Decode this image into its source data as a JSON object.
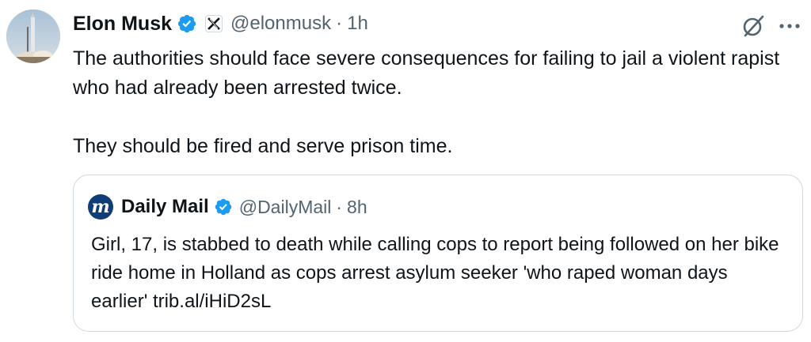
{
  "tweet": {
    "author": {
      "name": "Elon Musk",
      "handle": "@elonmusk",
      "avatar_icon": "rocket-launch-avatar",
      "verified_icon": "verified-badge-icon",
      "affiliation_icon": "x-logo-icon"
    },
    "separator": "·",
    "time": "1h",
    "paragraphs": [
      "The authorities should face severe consequences for failing to jail a violent rapist who had already been arrested twice.",
      "They should be fired and serve prison time."
    ],
    "actions": {
      "grok_icon": "grok-icon",
      "more_icon": "more-icon"
    },
    "quote": {
      "author": {
        "name": "Daily Mail",
        "handle": "@DailyMail",
        "avatar_letter": "m",
        "verified_icon": "verified-badge-icon"
      },
      "separator": "·",
      "time": "8h",
      "text": "Girl, 17, is stabbed to death while calling cops to report being followed on her bike ride home in Holland as cops arrest asylum seeker 'who raped woman days earlier' trib.al/iHiD2sL"
    }
  },
  "colors": {
    "text_primary": "#0f1419",
    "text_secondary": "#536471",
    "verified_blue": "#1d9bf0",
    "border": "#cfd9de",
    "daily_mail_navy": "#0e3d78"
  }
}
